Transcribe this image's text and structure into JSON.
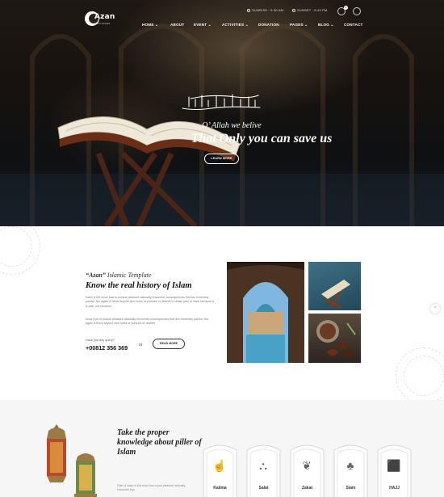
{
  "header": {
    "logo_text": "Azan",
    "logo_sub": "Islamic Template",
    "sunrise": "SUNRISE : 5:30 AM",
    "sunset": "SUNSET : 5:45 PM",
    "cart_count": "0",
    "nav": [
      {
        "label": "HOME ⌄"
      },
      {
        "label": "ABOUT"
      },
      {
        "label": "EVENT ⌄"
      },
      {
        "label": "ACTIVITIES ⌄"
      },
      {
        "label": "DONATION"
      },
      {
        "label": "PAGES ⌄"
      },
      {
        "label": "BLOG ⌄"
      },
      {
        "label": "CONTACT"
      }
    ]
  },
  "hero": {
    "tagline_1": "O’ Allah we belive",
    "tagline_2": "That Only you can save us",
    "button": "LEARN MORE"
  },
  "about": {
    "kicker_brand": "“Azan”",
    "kicker_rest": " Islamic Template",
    "heading": "Know the real history of Islam",
    "para1": "Islam is We know how to pursue pleasure rationally encounter consequences that are extremely painful. Nor again is there anyone who loves or pursues or desires to obtain pain of itself, because it is pain, but because",
    "para2": "know how to pursue pleasure rationally encounter consequences that are extremely painful. Nor again is there anyone who loves or pursues or desires",
    "ask": "Have you any query?",
    "phone": "+00812 356 369",
    "or": "or",
    "button": "READ MORE"
  },
  "pillars": {
    "title": "Take the proper knowledge about piller of Islam",
    "text": "Piller of Islam is We know how to pue pleasure rationally encounter equ.",
    "items": [
      {
        "label": "Kalima",
        "icon": "hand-icon"
      },
      {
        "label": "Salat",
        "icon": "prayer-icon"
      },
      {
        "label": "Zakat",
        "icon": "charity-icon"
      },
      {
        "label": "Siam",
        "icon": "palm-tree-icon"
      },
      {
        "label": "HAJJ",
        "icon": "kaaba-icon"
      }
    ]
  },
  "colors": {
    "dark": "#1f1914",
    "accent": "#111111"
  }
}
